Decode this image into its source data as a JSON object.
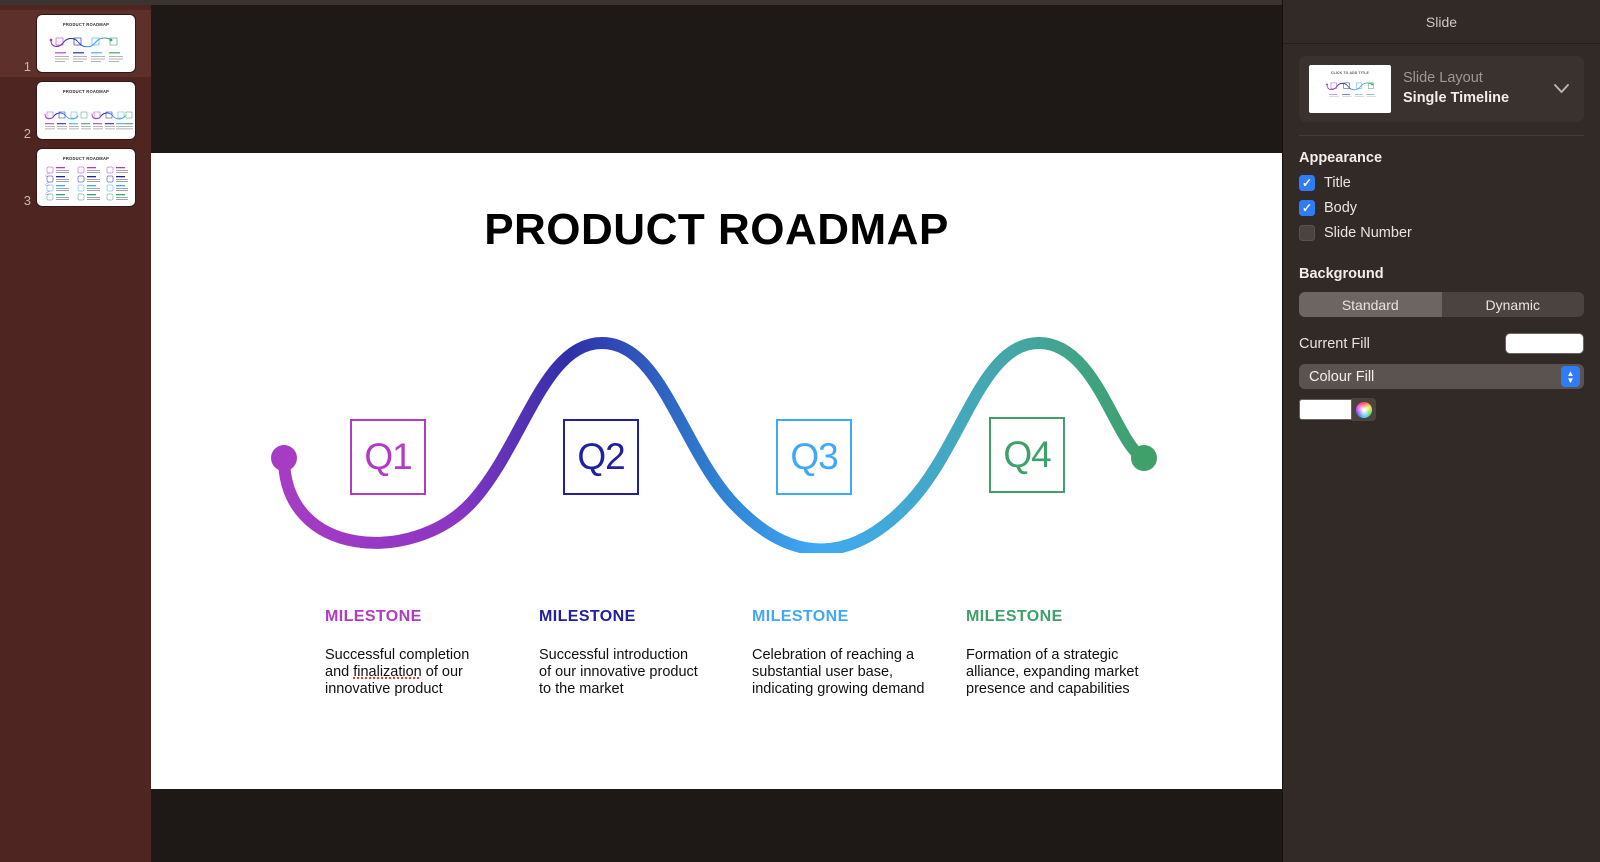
{
  "app": {
    "canvas_bg": "#1e1816",
    "navigator_bg": "#4e2521",
    "inspector_bg": "#322a27",
    "accent": "#2f7cf6"
  },
  "navigator": {
    "slides": [
      {
        "number": "1",
        "title": "PRODUCT ROADMAP",
        "selected": true,
        "variant": "single-timeline"
      },
      {
        "number": "2",
        "title": "PRODUCT ROADMAP",
        "selected": false,
        "variant": "double-timeline"
      },
      {
        "number": "3",
        "title": "PRODUCT ROADMAP",
        "selected": false,
        "variant": "three-column-list"
      }
    ]
  },
  "slide": {
    "title": "PRODUCT ROADMAP",
    "background_color": "#ffffff",
    "start_dot_color": "#a63cc4",
    "end_dot_color": "#3fa06a",
    "quarters": [
      {
        "key": "q1",
        "label": "Q1",
        "color": "#b13bc4",
        "milestone_heading": "MILESTONE",
        "milestone_body": "Successful completion and finalization of our innovative product",
        "misspelled_word": "finalization"
      },
      {
        "key": "q2",
        "label": "Q2",
        "color": "#2020a0",
        "milestone_heading": "MILESTONE",
        "milestone_body": "Successful introduction of our innovative product to the market"
      },
      {
        "key": "q3",
        "label": "Q3",
        "color": "#3fa9f5",
        "milestone_heading": "MILESTONE",
        "milestone_body": "Celebration of reaching a substantial user base, indicating growing demand"
      },
      {
        "key": "q4",
        "label": "Q4",
        "color": "#3fa06a",
        "milestone_heading": "MILESTONE",
        "milestone_body": "Formation of a strategic alliance, expanding market presence and capabilities"
      }
    ],
    "milestone_lines": {
      "q1": [
        "Successful completion",
        "and finalization of our",
        "innovative product"
      ],
      "q2": [
        "Successful introduction",
        "of our innovative product",
        "to the market"
      ],
      "q3": [
        "Celebration of reaching a",
        "substantial user base,",
        "indicating growing demand"
      ],
      "q4": [
        "Formation of a strategic",
        "alliance, expanding market",
        "presence and capabilities"
      ]
    }
  },
  "inspector": {
    "header": "Slide",
    "layout": {
      "label": "Slide Layout",
      "value": "Single Timeline",
      "thumb_title": "CLICK TO ADD TITLE",
      "chevron": "chevron-down"
    },
    "appearance": {
      "title": "Appearance",
      "options": [
        {
          "label": "Title",
          "checked": true
        },
        {
          "label": "Body",
          "checked": true
        },
        {
          "label": "Slide Number",
          "checked": false
        }
      ]
    },
    "background": {
      "title": "Background",
      "segments": [
        {
          "label": "Standard",
          "active": true
        },
        {
          "label": "Dynamic",
          "active": false
        }
      ],
      "current_fill_label": "Current Fill",
      "current_fill_color": "#ffffff",
      "fill_type": "Colour Fill",
      "fill_color": "#ffffff"
    }
  }
}
